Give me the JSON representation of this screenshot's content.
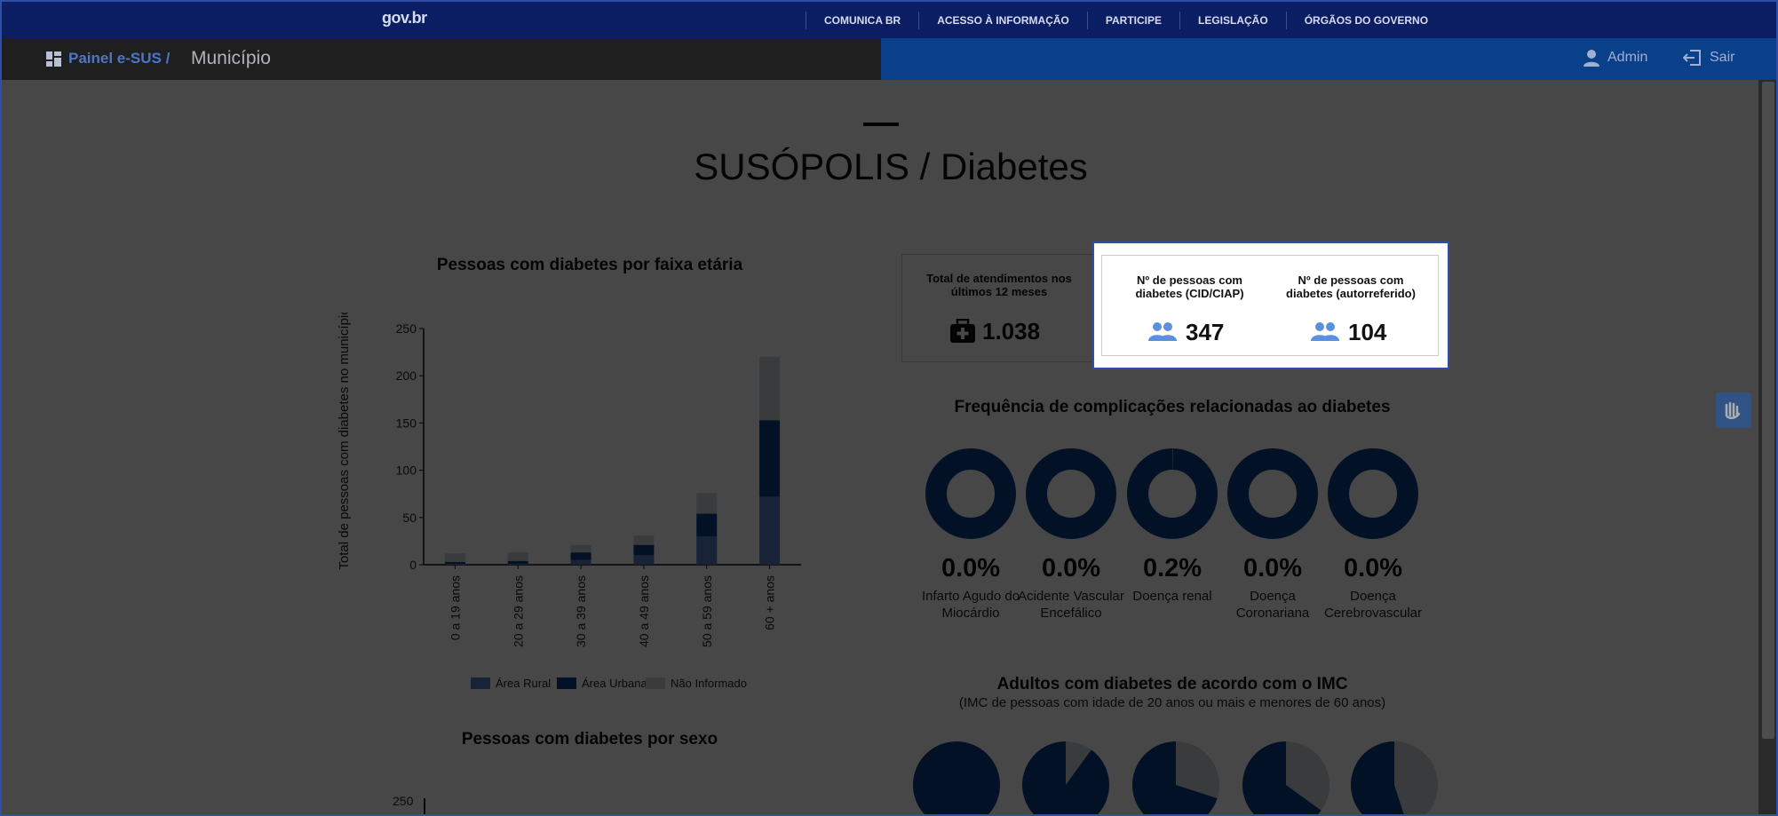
{
  "govbar": {
    "logo": "gov.br",
    "links": [
      "COMUNICA BR",
      "ACESSO À INFORMAÇÃO",
      "PARTICIPE",
      "LEGISLAÇÃO",
      "ÓRGÃOS DO GOVERNO"
    ]
  },
  "header": {
    "brand": "Painel e-SUS /",
    "crumb": "Município",
    "admin": "Admin",
    "logout": "Sair"
  },
  "page": {
    "title": "SUSÓPOLIS / Diabetes"
  },
  "kpis": {
    "atendimentos": {
      "label": "Total de atendimentos nos últimos 12 meses",
      "value": "1.038",
      "icon": "medkit-icon"
    },
    "cid": {
      "label": "Nº de pessoas com diabetes (CID/CIAP)",
      "value": "347",
      "icon": "people-icon"
    },
    "auto": {
      "label": "Nº de pessoas com diabetes (autorreferido)",
      "value": "104",
      "icon": "people-icon"
    }
  },
  "complicacoes": {
    "title": "Frequência de complicações relacionadas ao diabetes",
    "items": [
      {
        "value": "0.0%",
        "label": "Infarto Agudo do Miocárdio",
        "fraction": 0.0
      },
      {
        "value": "0.0%",
        "label": "Acidente Vascular Encefálico",
        "fraction": 0.0
      },
      {
        "value": "0.2%",
        "label": "Doença renal",
        "fraction": 0.002
      },
      {
        "value": "0.0%",
        "label": "Doença Coronariana",
        "fraction": 0.0
      },
      {
        "value": "0.0%",
        "label": "Doença Cerebrovascular",
        "fraction": 0.0
      }
    ]
  },
  "imc": {
    "title": "Adultos com diabetes de acordo com o IMC",
    "subtitle": "(IMC de pessoas com idade de 20 anos ou mais e menores de 60 anos)",
    "fractions": [
      1.0,
      0.9,
      0.7,
      0.65,
      0.55
    ]
  },
  "sexo": {
    "title": "Pessoas com diabetes por sexo",
    "first_tick": "250"
  },
  "colors": {
    "rural": "#5a7ec6",
    "urbana": "#0a3f8a",
    "nao_informado": "#cfd3da",
    "donut": "#0a3f8a",
    "donut_rest": "#cfd3da"
  },
  "chart_data": {
    "type": "bar",
    "title": "Pessoas com diabetes por faixa etária",
    "ylabel": "Total de pessoas com diabetes no município",
    "xlabel": "",
    "ylim": [
      0,
      250
    ],
    "yticks": [
      0,
      50,
      100,
      150,
      200,
      250
    ],
    "stacked": true,
    "categories": [
      "0 a 19 anos",
      "20 a 29 anos",
      "30 a 39 anos",
      "40 a 49 anos",
      "50 a 59 anos",
      "60 + anos"
    ],
    "series": [
      {
        "name": "Área Rural",
        "values": [
          1,
          1,
          5,
          10,
          30,
          72
        ]
      },
      {
        "name": "Área Urbana",
        "values": [
          2,
          3,
          8,
          11,
          24,
          81
        ]
      },
      {
        "name": "Não Informado",
        "values": [
          9,
          9,
          8,
          10,
          22,
          67
        ]
      }
    ],
    "legend": "bottom"
  }
}
